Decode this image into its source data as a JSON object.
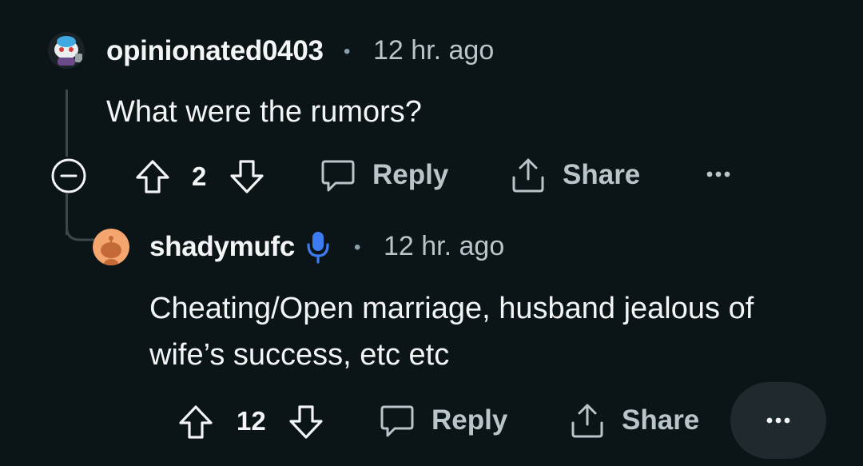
{
  "comment1": {
    "username": "opinionated0403",
    "separator": "•",
    "time": "12 hr. ago",
    "body": "What were the rumors?",
    "vote_count": "2",
    "reply_label": "Reply",
    "share_label": "Share",
    "avatar_icon": "snoo-avatar-icon"
  },
  "comment2": {
    "username": "shadymufc",
    "badge_icon": "microphone-icon",
    "separator": "•",
    "time": "12 hr. ago",
    "body_line1": "Cheating/Open marriage, husband jealous of",
    "body_line2": "wife’s success, etc etc",
    "vote_count": "12",
    "reply_label": "Reply",
    "share_label": "Share",
    "avatar_icon": "default-snoo-avatar-icon"
  },
  "colors": {
    "background": "#0b1416",
    "muted_text": "#b8c5c9",
    "mic_blue": "#3d7bf0",
    "avatar_orange": "#f5a66e",
    "more_pill": "#1f2a2e"
  }
}
